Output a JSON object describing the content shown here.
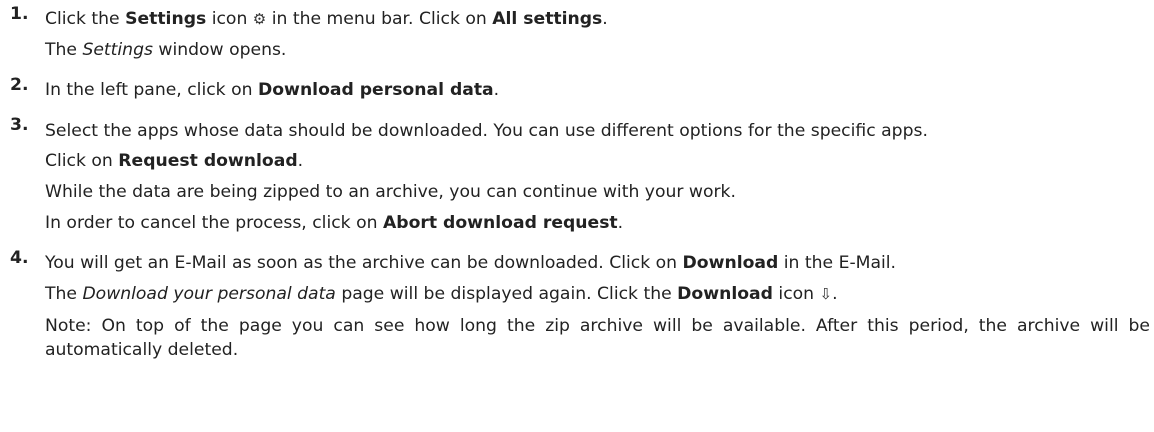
{
  "steps": [
    {
      "number": "1.",
      "lines": [
        {
          "parts": [
            {
              "t": "Click the "
            },
            {
              "t": "Settings",
              "b": true
            },
            {
              "t": " icon "
            },
            {
              "icon": "settings-icon",
              "glyph": "⚙"
            },
            {
              "t": " in the menu bar. Click on "
            },
            {
              "t": "All settings",
              "b": true
            },
            {
              "t": "."
            }
          ]
        },
        {
          "parts": [
            {
              "t": "The "
            },
            {
              "t": "Settings",
              "i": true
            },
            {
              "t": " window opens."
            }
          ]
        }
      ]
    },
    {
      "number": "2.",
      "lines": [
        {
          "parts": [
            {
              "t": "In the left pane, click on "
            },
            {
              "t": "Download personal data",
              "b": true
            },
            {
              "t": "."
            }
          ]
        }
      ]
    },
    {
      "number": "3.",
      "lines": [
        {
          "wrap": true,
          "parts": [
            {
              "t": "Select the apps whose data should be downloaded. You can use different options for the specific apps."
            }
          ]
        },
        {
          "parts": [
            {
              "t": "Click on "
            },
            {
              "t": "Request download",
              "b": true
            },
            {
              "t": "."
            }
          ]
        },
        {
          "parts": [
            {
              "t": "While the data are being zipped to an archive, you can continue with your work."
            }
          ]
        },
        {
          "parts": [
            {
              "t": "In order to cancel the process, click on "
            },
            {
              "t": "Abort download request",
              "b": true
            },
            {
              "t": "."
            }
          ]
        }
      ]
    },
    {
      "number": "4.",
      "lines": [
        {
          "parts": [
            {
              "t": "You will get an E-Mail as soon as the archive can be downloaded. Click on "
            },
            {
              "t": "Download",
              "b": true
            },
            {
              "t": " in the E-Mail."
            }
          ]
        },
        {
          "parts": [
            {
              "t": "The "
            },
            {
              "t": "Download your personal data",
              "i": true
            },
            {
              "t": " page will be displayed again. Click the "
            },
            {
              "t": "Download",
              "b": true
            },
            {
              "t": " icon "
            },
            {
              "icon": "download-icon",
              "glyph": "⇩"
            },
            {
              "t": "."
            }
          ]
        },
        {
          "wrap": true,
          "parts": [
            {
              "t": "Note: On top of the page you can see how long the zip archive will be available. After this period, the archive will be automatically deleted."
            }
          ]
        }
      ]
    }
  ]
}
